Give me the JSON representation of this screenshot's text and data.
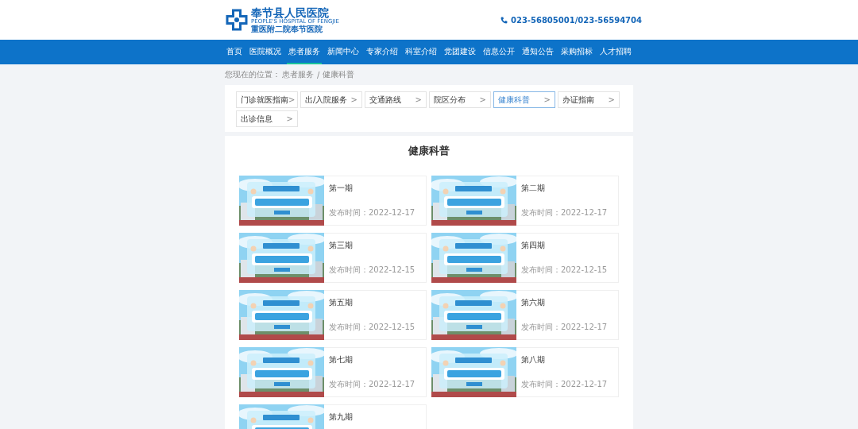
{
  "header": {
    "logo_title": "奉节县人民医院",
    "logo_subtitle": "PEOPLE'S HOSPITAL OF FENGJIE",
    "logo_name2": "重医附二院奉节医院",
    "phone": "023-56805001/023-56594704"
  },
  "nav": [
    {
      "label": "首页",
      "selected": false
    },
    {
      "label": "医院概况",
      "selected": false
    },
    {
      "label": "患者服务",
      "selected": true
    },
    {
      "label": "新闻中心",
      "selected": false
    },
    {
      "label": "专家介绍",
      "selected": false
    },
    {
      "label": "科室介绍",
      "selected": false
    },
    {
      "label": "党团建设",
      "selected": false
    },
    {
      "label": "信息公开",
      "selected": false
    },
    {
      "label": "通知公告",
      "selected": false
    },
    {
      "label": "采购招标",
      "selected": false
    },
    {
      "label": "人才招聘",
      "selected": false
    }
  ],
  "breadcrumb": {
    "label": "您现在的位置：",
    "items": [
      "患者服务",
      "健康科普"
    ],
    "separator": "/"
  },
  "subnav": [
    {
      "label": "门诊就医指南",
      "arrow": ">",
      "selected": false
    },
    {
      "label": "出/入院服务",
      "arrow": ">",
      "selected": false
    },
    {
      "label": "交通路线",
      "arrow": ">",
      "selected": false
    },
    {
      "label": "院区分布",
      "arrow": ">",
      "selected": false
    },
    {
      "label": "健康科普",
      "arrow": ">",
      "selected": true
    },
    {
      "label": "办证指南",
      "arrow": ">",
      "selected": false
    },
    {
      "label": "出诊信息",
      "arrow": ">",
      "selected": false
    }
  ],
  "section_title": "健康科普",
  "articles": [
    {
      "title": "第一期",
      "date_label": "发布时间：",
      "date": "2022-12-17"
    },
    {
      "title": "第二期",
      "date_label": "发布时间：",
      "date": "2022-12-17"
    },
    {
      "title": "第三期",
      "date_label": "发布时间：",
      "date": "2022-12-15"
    },
    {
      "title": "第四期",
      "date_label": "发布时间：",
      "date": "2022-12-15"
    },
    {
      "title": "第五期",
      "date_label": "发布时间：",
      "date": "2022-12-15"
    },
    {
      "title": "第六期",
      "date_label": "发布时间：",
      "date": "2022-12-17"
    },
    {
      "title": "第七期",
      "date_label": "发布时间：",
      "date": "2022-12-17"
    },
    {
      "title": "第八期",
      "date_label": "发布时间：",
      "date": "2022-12-17"
    },
    {
      "title": "第九期"
    }
  ]
}
